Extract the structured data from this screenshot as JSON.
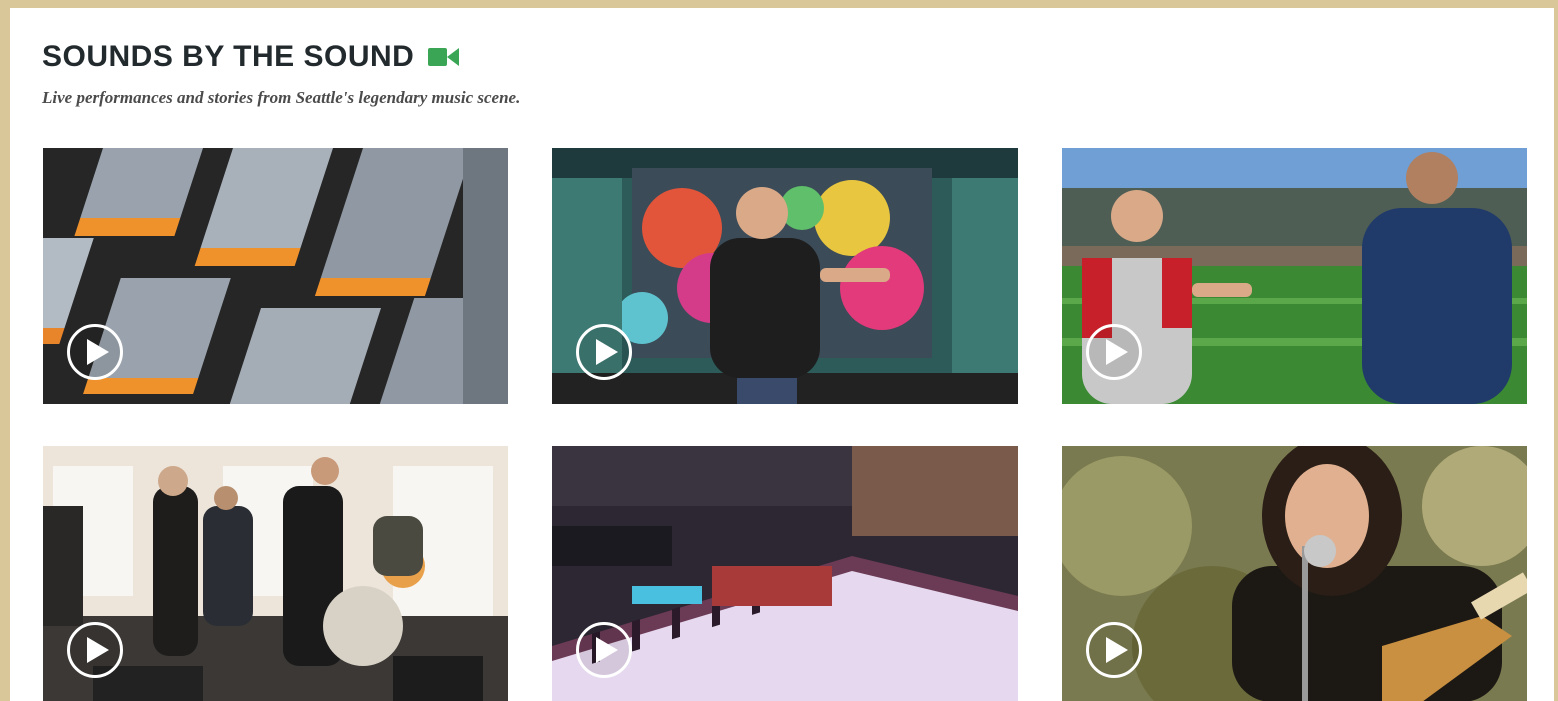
{
  "section": {
    "title": "SOUNDS BY THE SOUND",
    "subtitle": "Live performances and stories from Seattle's legendary music scene."
  },
  "colors": {
    "frame": "#d9c79a",
    "title": "#222a2e",
    "camera_icon": "#3aa655",
    "play_icon": "#ffffff"
  },
  "videos": [
    {
      "thumbnail": "KEXP 3D logo letters",
      "icon": "play-icon"
    },
    {
      "thumbnail": "Man in front of colorful mural stage",
      "icon": "play-icon"
    },
    {
      "thumbnail": "Two men at Safeco Field baseball stadium",
      "icon": "play-icon"
    },
    {
      "thumbnail": "Band performing in bright room",
      "icon": "play-icon"
    },
    {
      "thumbnail": "Synthesizer keyboard close-up",
      "icon": "play-icon"
    },
    {
      "thumbnail": "Woman singing with guitar at microphone",
      "icon": "play-icon"
    }
  ]
}
